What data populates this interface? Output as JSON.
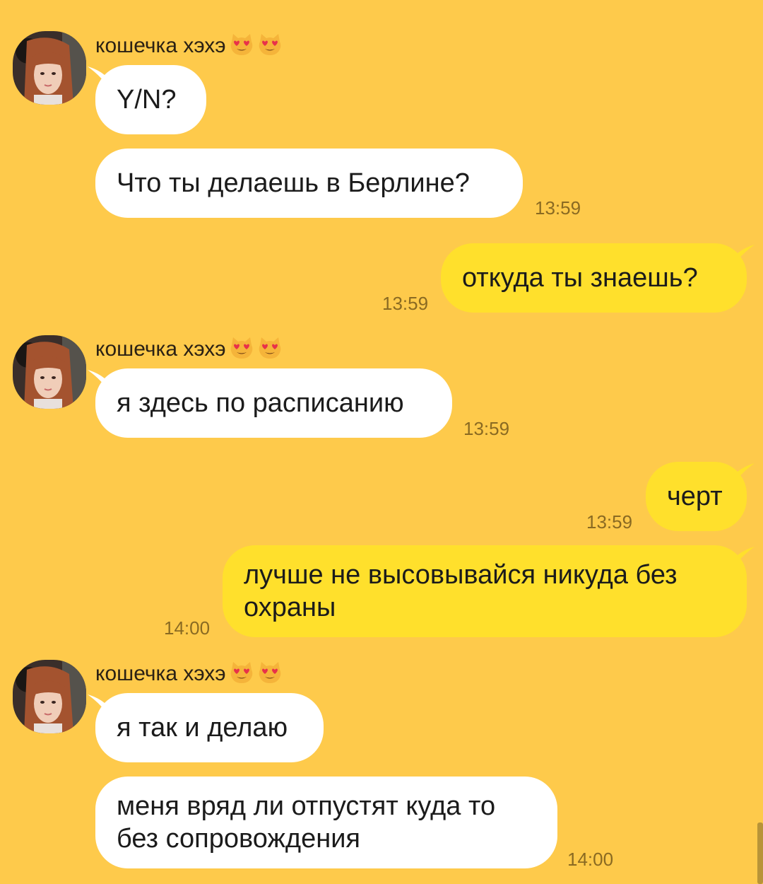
{
  "sender": {
    "name": "кошечка хэхэ",
    "emoji_1": "heart-eyes-cat",
    "emoji_2": "heart-eyes-cat"
  },
  "colors": {
    "background": "#FECA4B",
    "incoming_bubble": "#FFFFFF",
    "outgoing_bubble": "#FFE02C",
    "timestamp": "#8a6a22"
  },
  "messages": [
    {
      "direction": "incoming",
      "text": "Y/N?",
      "time": ""
    },
    {
      "direction": "incoming",
      "text": "Что ты делаешь в Берлине?",
      "time": "13:59"
    },
    {
      "direction": "outgoing",
      "text": "откуда ты знаешь?",
      "time": "13:59"
    },
    {
      "direction": "incoming",
      "text": "я здесь по расписанию",
      "time": "13:59"
    },
    {
      "direction": "outgoing",
      "text": "черт",
      "time": "13:59"
    },
    {
      "direction": "outgoing",
      "text": "лучше не высовывайся никуда без охраны",
      "time": "14:00"
    },
    {
      "direction": "incoming",
      "text": "я так и делаю",
      "time": ""
    },
    {
      "direction": "incoming",
      "text": "меня вряд ли отпустят куда то без сопровождения",
      "time": "14:00"
    }
  ]
}
